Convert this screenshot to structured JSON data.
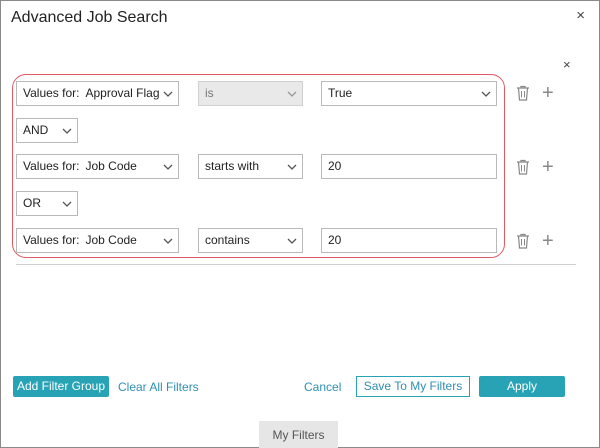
{
  "dialog": {
    "title": "Advanced Job Search",
    "close_symbol": "×",
    "group_close_symbol": "×"
  },
  "rows": [
    {
      "field_prefix": "Values for:",
      "field": "Approval Flag",
      "operator": "is",
      "operator_disabled": true,
      "value": "True",
      "value_type": "select"
    },
    {
      "field_prefix": "Values for:",
      "field": "Job Code",
      "operator": "starts with",
      "operator_disabled": false,
      "value": "20",
      "value_type": "text"
    },
    {
      "field_prefix": "Values for:",
      "field": "Job Code",
      "operator": "contains",
      "operator_disabled": false,
      "value": "20",
      "value_type": "text"
    }
  ],
  "connectors": [
    "AND",
    "OR"
  ],
  "footer": {
    "add_filter_group": "Add Filter Group",
    "clear_all_filters": "Clear All Filters",
    "cancel": "Cancel",
    "save_to_my_filters": "Save To My Filters",
    "apply": "Apply"
  },
  "bottom_tab": {
    "label": "My Filters"
  },
  "icons": {
    "delete": "trash-icon",
    "add": "plus-icon",
    "dropdown": "chevron-down-icon"
  },
  "colors": {
    "accent": "#27a3b5",
    "group_border": "#e05a66",
    "link": "#2f8fb0"
  }
}
